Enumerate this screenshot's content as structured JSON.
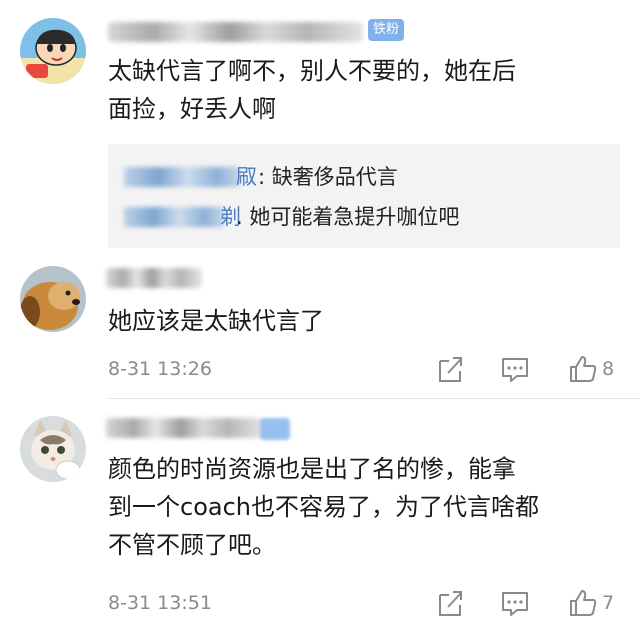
{
  "comments": [
    {
      "avatar": "crayon-shin-chan-avatar",
      "badge": "铁粉",
      "text_lines": [
        "太缺代言了啊不，别人不要的，她在后",
        "面捡，好丢人啊"
      ],
      "replies": [
        {
          "name_tail": "㕞",
          "text": ": 缺奢侈品代言"
        },
        {
          "name_tail": "剃",
          "text": ". 她可能着急提升咖位吧"
        }
      ]
    },
    {
      "avatar": "dog-avatar",
      "text_lines": [
        "她应该是太缺代言了"
      ],
      "time": "8-31 13:26",
      "likes": "8"
    },
    {
      "avatar": "cat-avatar",
      "text_lines": [
        "颜色的时尚资源也是出了名的惨，能拿",
        "到一个coach也不容易了，为了代言啥都",
        "不管不顾了吧。"
      ],
      "time": "8-31 13:51",
      "likes": "7"
    }
  ],
  "icons": {
    "share": "share-icon",
    "reply": "comment-icon",
    "like": "thumbs-up-icon"
  },
  "colors": {
    "badge": "#7fb1ea",
    "meta": "#8a8a8a",
    "reply_bg": "#f3f3f3"
  }
}
